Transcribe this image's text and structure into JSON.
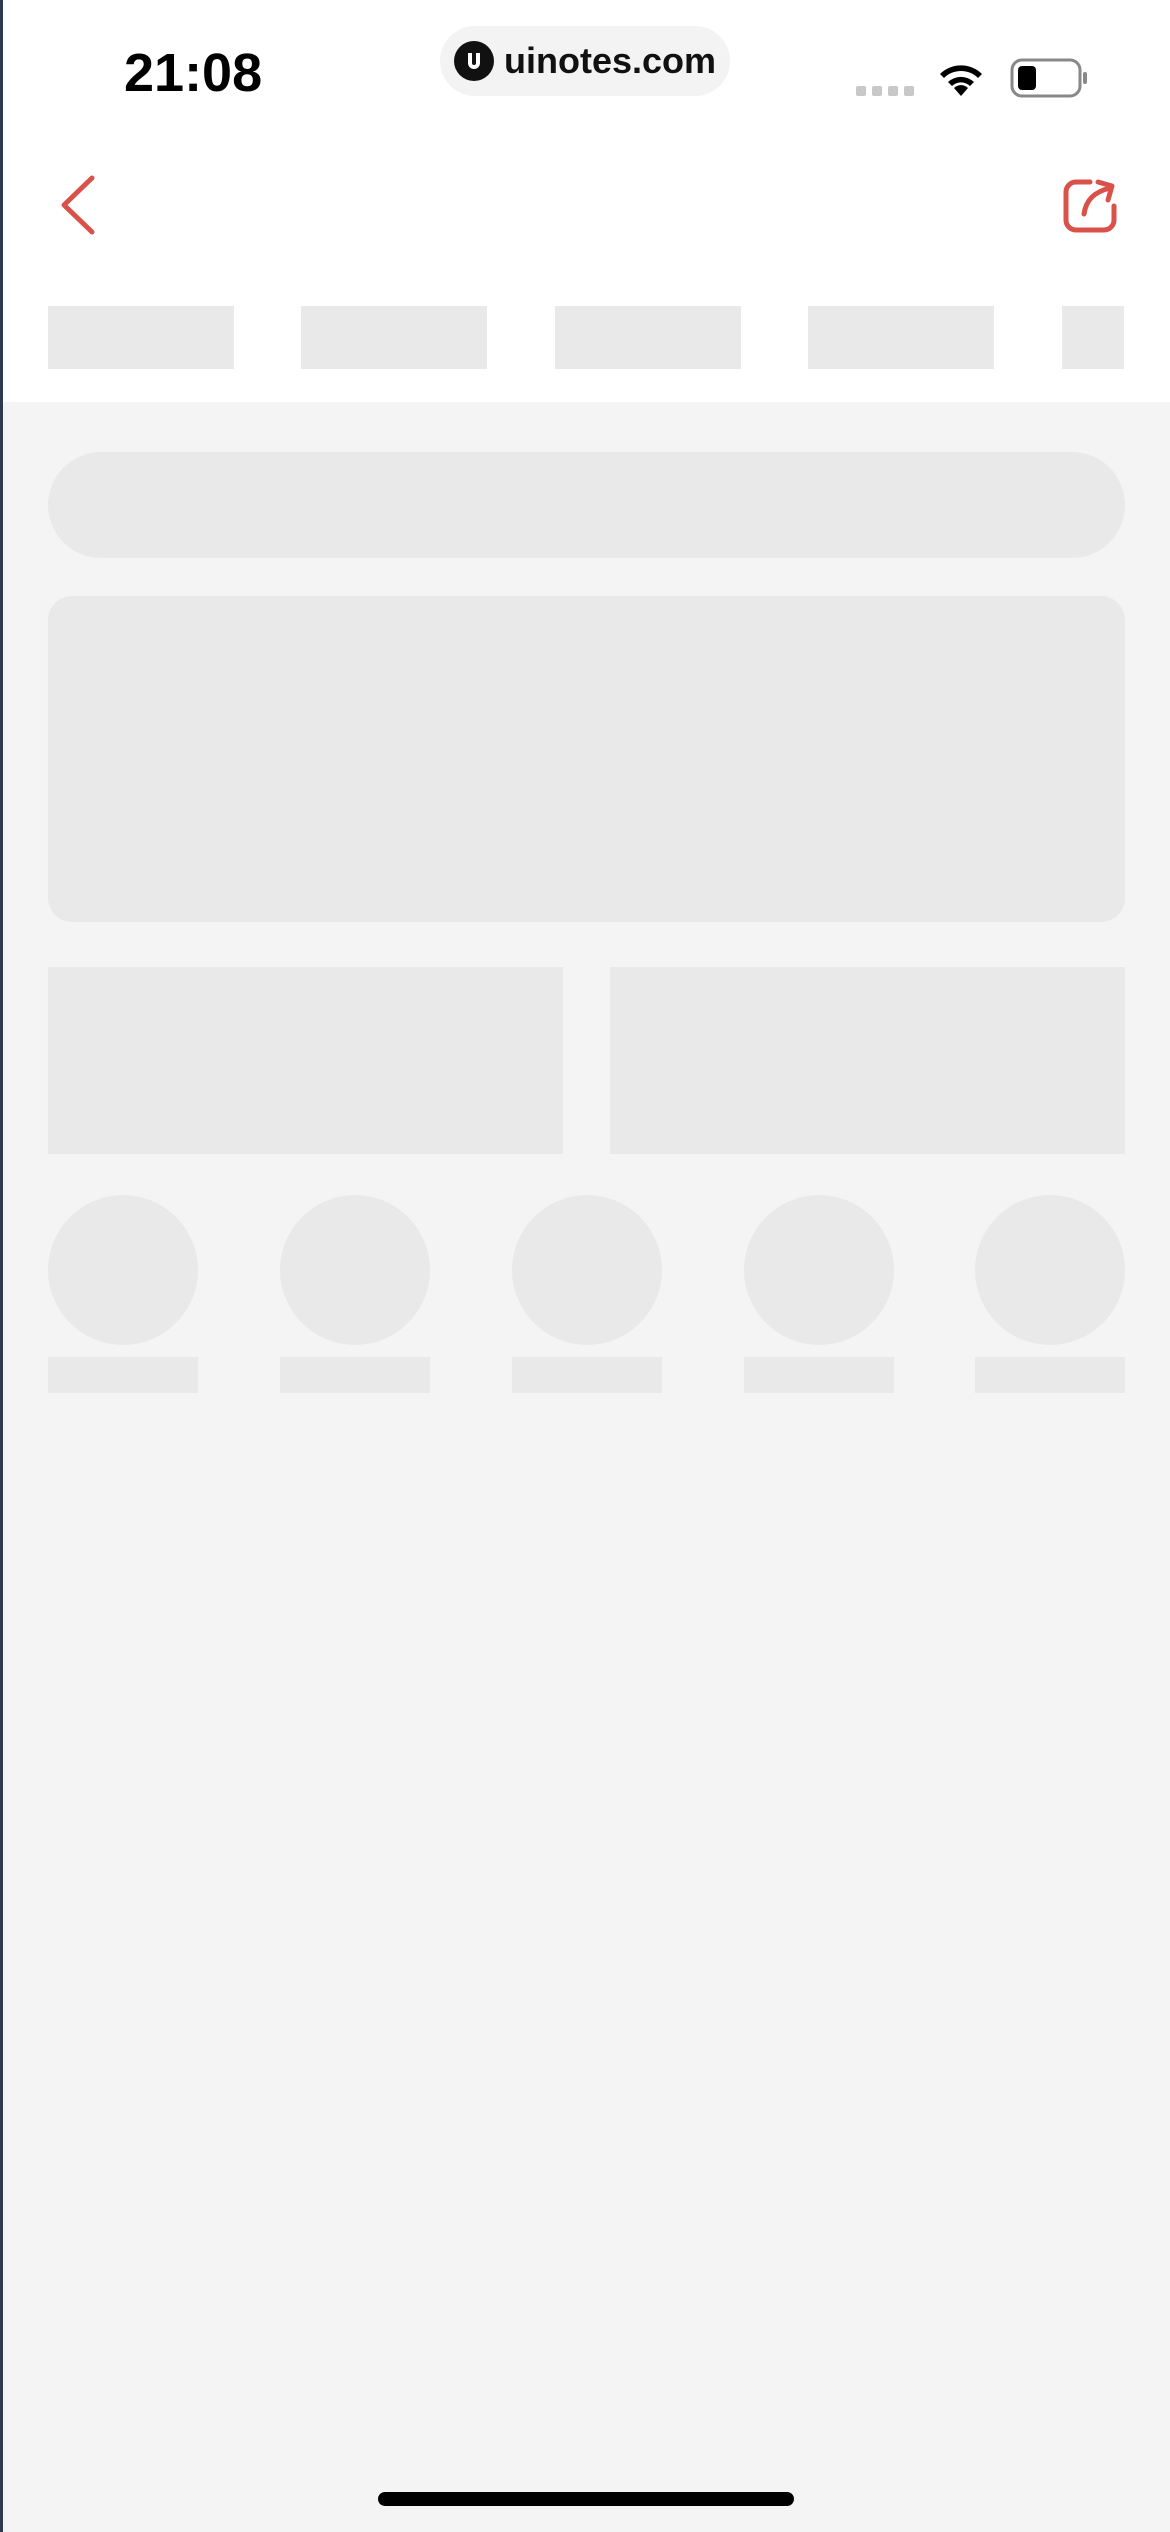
{
  "status_bar": {
    "time": "21:08",
    "url": "uinotes.com",
    "icons": [
      "signal-icon",
      "wifi-icon",
      "battery-icon"
    ]
  },
  "nav": {
    "back_icon": "chevron-left-icon",
    "share_icon": "share-icon",
    "accent_color": "#d9524a"
  },
  "skeleton": {
    "tab_count": 5,
    "shortcut_count": 5,
    "color": "#e9e9e9"
  }
}
